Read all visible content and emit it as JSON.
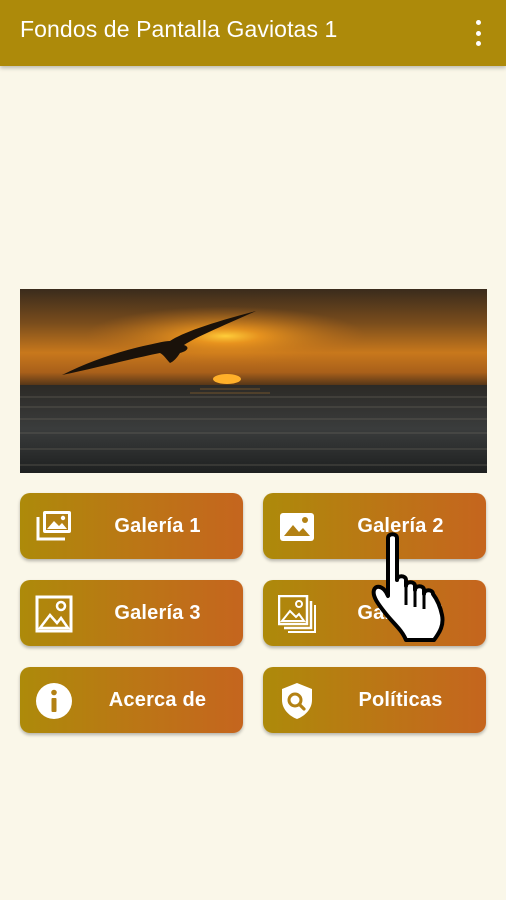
{
  "appbar": {
    "title": "Fondos de Pantalla Gaviotas 1",
    "menu_icon": "more-vert-icon"
  },
  "banner": {
    "image": "seagull-sunset-ocean-photo"
  },
  "buttons": [
    {
      "label": "Galería 1",
      "icon": "photo-library-icon"
    },
    {
      "label": "Galería 2",
      "icon": "image-icon"
    },
    {
      "label": "Galería 3",
      "icon": "picture-frame-icon"
    },
    {
      "label": "Galería 4",
      "icon": "picture-stack-icon"
    },
    {
      "label": "Acerca de",
      "icon": "info-icon"
    },
    {
      "label": "Políticas",
      "icon": "shield-search-icon"
    }
  ],
  "overlay": {
    "icon": "tap-hand-cursor-icon"
  },
  "colors": {
    "appbar": "#ad8a0a",
    "background": "#faf7e9",
    "button_start": "#ad8a0a",
    "button_end": "#c5651e"
  }
}
